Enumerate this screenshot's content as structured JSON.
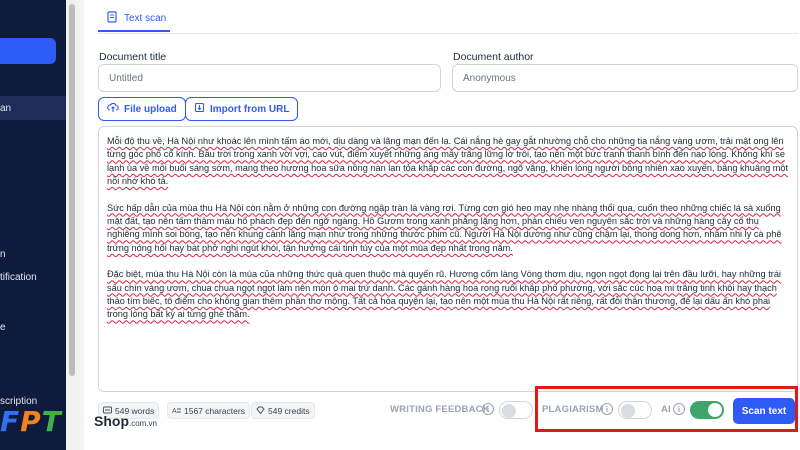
{
  "sidebar": {
    "items": [
      {
        "label": "an"
      },
      {
        "label": "n"
      },
      {
        "label": "tification"
      },
      {
        "label": "e"
      },
      {
        "label": "scription"
      }
    ]
  },
  "tabs": [
    {
      "label": "Text scan",
      "icon": "document-icon"
    }
  ],
  "form": {
    "title_label": "Document title",
    "title_value": "Untitled",
    "author_label": "Document author",
    "author_value": "Anonymous"
  },
  "actions": {
    "file_upload": "File upload",
    "import_url": "Import from URL"
  },
  "document": {
    "paragraphs": [
      "Mỗi độ thu về, Hà Nội như khoác lên mình tấm áo mới, dịu dàng và lãng mạn đến lạ. Cái nắng hè gay gắt nhường chỗ cho những tia nắng vàng ươm, trải mật ong lên từng góc phố cổ kính. Bầu trời trong xanh vời vợi, cao vút, điểm xuyết những áng mây trắng lững lờ trôi, tạo nên một bức tranh thanh bình đến nao lòng. Không khí se lạnh ùa về mỗi buổi sáng sớm, mang theo hương hoa sữa nồng nàn lan tỏa khắp các con đường, ngõ vắng, khiến lòng người bỗng nhiên xao xuyến, bâng khuâng một nỗi nhớ khó tả.",
      "Sức hấp dẫn của mùa thu Hà Nội còn nằm ở những con đường ngập tràn lá vàng rơi. Từng cơn gió heo may nhẹ nhàng thổi qua, cuốn theo những chiếc lá sà xuống mặt đất, tạo nên tấm thảm màu hổ phách đẹp đến ngỡ ngàng. Hồ Gươm trong xanh phẳng lặng hơn, phản chiếu ven nguyên sắc trời và những hàng cây cổ thụ nghiêng mình soi bóng, tạo nên khung cảnh lãng mạn như trong những thước phim cũ. Người Hà Nội dường như cũng chậm lại, thong dong hơn, nhâm nhi ly cà phê trứng nóng hổi hay bát phở nghi ngút khói, tận hưởng cái tinh túy của một mùa đẹp nhất trong năm.",
      "Đặc biệt, mùa thu Hà Nội còn là mùa của những thức quà quen thuộc mà quyến rũ. Hương cốm làng Vòng thơm dịu, ngọn ngọt đọng lại trên đầu lưỡi, hay những trái sấu chín vàng ươm, chua chua ngọt ngọt làm nên món ô mai trứ danh. Các gánh hàng hoa rong ruổi khắp phố phường, với sắc cúc hoạ mi trắng tinh khôi hay thạch thảo tím biếc, tô điểm cho không gian thêm phần thơ mộng. Tất cả hòa quyện lại, tạo nên một mùa thu Hà Nội rất riêng, rất đỗi thân thương, để lại dấu ấn khó phai trong lòng bất kỳ ai từng ghé thăm."
    ]
  },
  "stats": {
    "words": "549 words",
    "characters": "1567 characters",
    "credits": "549 credits"
  },
  "options": {
    "writing_feedback": {
      "label": "WRITING FEEDBACK",
      "enabled": false
    },
    "plagiarism": {
      "label": "PLAGIARISM",
      "enabled": false
    },
    "ai": {
      "label": "AI",
      "enabled": true
    }
  },
  "scan_button": "Scan text",
  "logo": {
    "letters": [
      "F",
      "P",
      "T"
    ],
    "shop": "Shop",
    "domain": ".com.vn"
  },
  "colors": {
    "accent": "#2f5bf5",
    "sidebar_bg": "#0f1b3d",
    "toggle_on": "#3fa66b",
    "highlight": "#e01818",
    "logo_f": "#2f6ff0",
    "logo_p": "#f58220",
    "logo_t": "#3fb04a"
  }
}
